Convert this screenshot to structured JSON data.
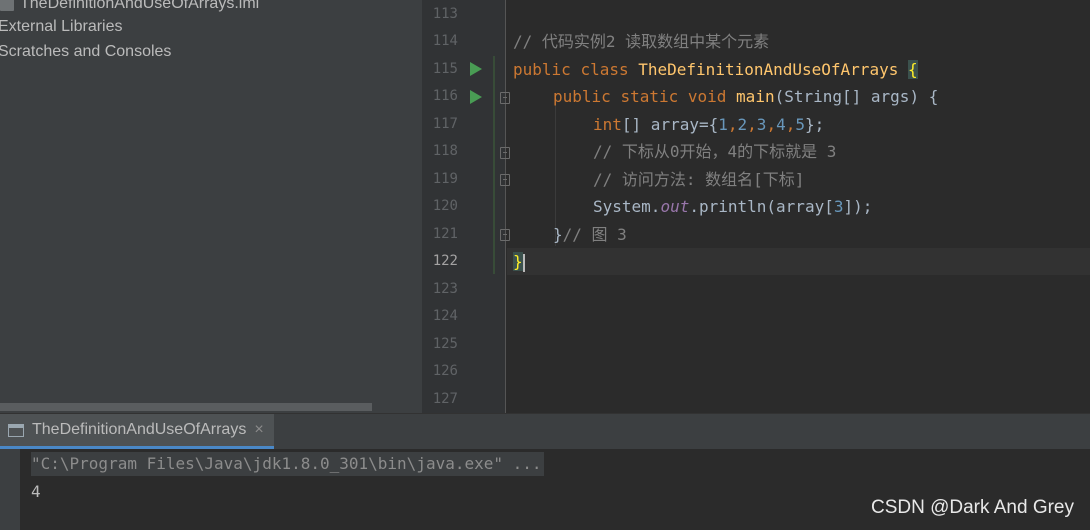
{
  "project_tree": {
    "items": [
      {
        "label": "TheDefinitionAndUseOfArrays.iml",
        "icon": "iml-file-icon"
      },
      {
        "label": "External Libraries",
        "icon": "library-icon"
      },
      {
        "label": "Scratches and Consoles",
        "icon": "scratches-icon"
      }
    ]
  },
  "editor": {
    "current_line": "122",
    "line_numbers": [
      "113",
      "114",
      "115",
      "116",
      "117",
      "118",
      "119",
      "120",
      "121",
      "122",
      "123",
      "124",
      "125",
      "126",
      "127"
    ],
    "code": {
      "l114": {
        "comment": "// 代码实例2 读取数组中某个元素"
      },
      "l115": {
        "kw1": "public",
        "kw2": "class",
        "name": "TheDefinitionAndUseOfArrays",
        "brace": "{"
      },
      "l116": {
        "kw1": "public",
        "kw2": "static",
        "kw3": "void",
        "name": "main",
        "rest": "(String[] args) {"
      },
      "l117": {
        "kw": "int",
        "a": "[] array={",
        "n1": "1",
        "c1": ",",
        "n2": "2",
        "c2": ",",
        "n3": "3",
        "c3": ",",
        "n4": "4",
        "c4": ",",
        "n5": "5",
        "end": "};"
      },
      "l118": {
        "comment": "// 下标从0开始，4的下标就是 3"
      },
      "l119": {
        "comment": "// 访问方法: 数组名[下标]"
      },
      "l120": {
        "a": "System.",
        "field": "out",
        "b": ".println(array[",
        "n": "3",
        "c": "]);"
      },
      "l121": {
        "a": "}",
        "comment": "// 图 3"
      },
      "l122": {
        "brace": "}"
      }
    },
    "colors": {
      "keyword": "#cc7832",
      "class_name": "#ffc66d",
      "number": "#6897bb",
      "comment": "#808080",
      "field": "#9876aa",
      "text": "#a9b7c6"
    }
  },
  "run_panel": {
    "tab_label": "TheDefinitionAndUseOfArrays",
    "tab_close": "×",
    "command": "\"C:\\Program Files\\Java\\jdk1.8.0_301\\bin\\java.exe\" ...",
    "output": "4"
  },
  "watermark": "CSDN @Dark And Grey"
}
